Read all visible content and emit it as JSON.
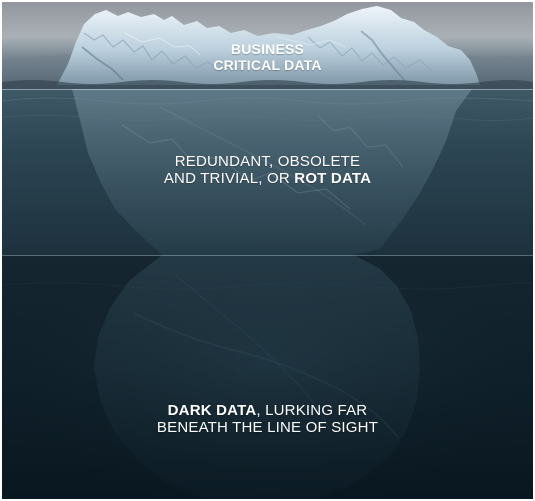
{
  "diagram": {
    "top_section": {
      "line_1": "BUSINESS",
      "line_2": "CRITICAL DATA"
    },
    "middle_section": {
      "line_1": "REDUNDANT, OBSOLETE",
      "line_2_prefix": "AND TRIVIAL, OR ",
      "line_2_bold": "ROT DATA"
    },
    "bottom_section": {
      "line_1_bold": "DARK DATA",
      "line_1_suffix": ", LURKING FAR",
      "line_2": "BENEATH THE LINE OF SIGHT"
    }
  },
  "colors": {
    "sky": "#8a8f96",
    "iceberg_top": "#d9e6ef",
    "shallow_water": "#2d4654",
    "deep_water": "#0b1a22",
    "text": "#ffffff"
  },
  "icons": [
    "iceberg-graphic"
  ]
}
